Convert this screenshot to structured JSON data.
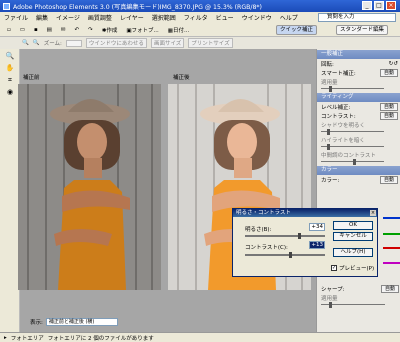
{
  "window": {
    "title": "Adobe Photoshop Elements 3.0 (写真編集モード)IMG_8370.JPG @ 15.3% (RGB/8*)"
  },
  "menu": [
    "ファイル",
    "編集",
    "イメージ",
    "画質調整",
    "レイヤー",
    "選択範囲",
    "フィルタ",
    "ビュー",
    "ウインドウ",
    "ヘルプ"
  ],
  "help_placeholder": "質問を入力",
  "toolbar": {
    "create_label": "作成",
    "photo_label": "フォトブ...",
    "date_label": "日付...",
    "quick_fix_label": "クイック補正",
    "standard_edit_label": "スタンダード編集"
  },
  "toolbar2": {
    "zoom_label": "ズーム:",
    "btn1": "ウインドウにあわせる",
    "btn2": "画面サイズ",
    "btn3": "プリントサイズ"
  },
  "canvas": {
    "before_label": "補正前",
    "after_label": "補正後",
    "show_label": "表示:",
    "show_value": "補正前と補正後 (横)"
  },
  "status": {
    "text": "フォトエリア",
    "hint": "フォトエリアに 2 個のファイルがあります"
  },
  "panel": {
    "general": "一般補正",
    "rotate": "回転:",
    "smart": "スマート補正:",
    "auto": "自動",
    "amount": "適用量",
    "lighting": "ライティング",
    "levels": "レベル補正:",
    "contrast": "コントラスト:",
    "shadows": "シャドウを明るく",
    "highlights": "ハイライトを暗く",
    "midtone": "中間調のコントラスト",
    "color": "カラー",
    "color_label": "カラー:",
    "sharpen": "シャープ:",
    "sharpen_amount": "適用量"
  },
  "dialog": {
    "title": "明るさ・コントラスト",
    "brightness_label": "明るさ(B):",
    "brightness_value": "+34",
    "contrast_label": "コントラスト(C):",
    "contrast_value": "+13",
    "ok": "OK",
    "cancel": "キャンセル",
    "help": "ヘルプ(H)",
    "preview": "プレビュー(P)",
    "brightness": 34,
    "contrast": 13
  },
  "accent_colors": {
    "titlebar": "#1b4bb8",
    "panel_header": "#6e8bc2",
    "quick_fix": "#c6d6f0"
  }
}
